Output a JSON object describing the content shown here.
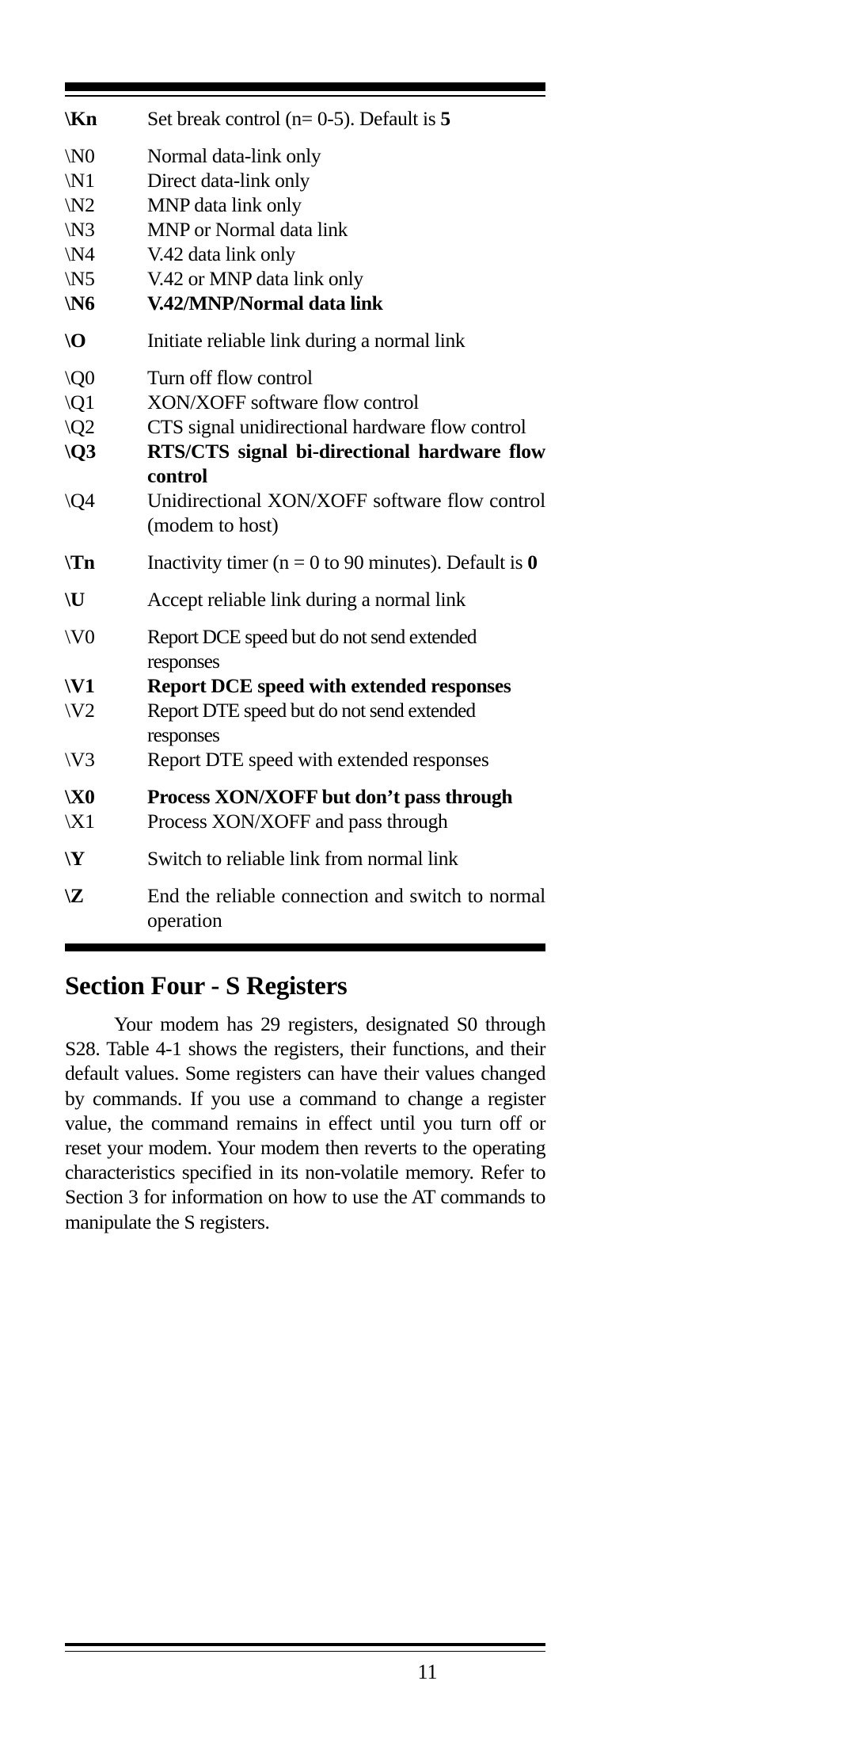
{
  "page": {
    "number": "11"
  },
  "command_table": {
    "rows": [
      {
        "label": "\\Kn",
        "desc_pre": "Set break control (n= 0-5). Default is ",
        "desc_bold_tail": "5",
        "label_bold": true,
        "desc_bold": false,
        "spacing": "none"
      },
      {
        "label": "\\N0",
        "desc": "Normal data-link only",
        "label_bold": false,
        "desc_bold": false,
        "spacing": "gap"
      },
      {
        "label": "\\N1",
        "desc": "Direct data-link only",
        "label_bold": false,
        "desc_bold": false,
        "spacing": "none"
      },
      {
        "label": "\\N2",
        "desc": "MNP data link only",
        "label_bold": false,
        "desc_bold": false,
        "spacing": "none"
      },
      {
        "label": "\\N3",
        "desc": "MNP or Normal data link",
        "label_bold": false,
        "desc_bold": false,
        "spacing": "none"
      },
      {
        "label": "\\N4",
        "desc": "V.42 data link only",
        "label_bold": false,
        "desc_bold": false,
        "spacing": "none"
      },
      {
        "label": "\\N5",
        "desc": "V.42 or MNP data link only",
        "label_bold": false,
        "desc_bold": false,
        "spacing": "none"
      },
      {
        "label": "\\N6",
        "desc": "V.42/MNP/Normal data link",
        "label_bold": true,
        "desc_bold": true,
        "spacing": "none"
      },
      {
        "label": "\\O",
        "desc": "Initiate reliable link during a normal link",
        "label_bold": true,
        "desc_bold": false,
        "spacing": "gap"
      },
      {
        "label": "\\Q0",
        "desc": "Turn off flow control",
        "label_bold": false,
        "desc_bold": false,
        "spacing": "gap"
      },
      {
        "label": "\\Q1",
        "desc": "XON/XOFF software flow control",
        "label_bold": false,
        "desc_bold": false,
        "spacing": "none"
      },
      {
        "label": "\\Q2",
        "desc": "CTS signal unidirectional hardware flow control",
        "label_bold": false,
        "desc_bold": false,
        "spacing": "none"
      },
      {
        "label": "\\Q3",
        "desc": "RTS/CTS signal bi-directional hardware flow control",
        "label_bold": true,
        "desc_bold": true,
        "spacing": "none",
        "justify": true
      },
      {
        "label": "\\Q4",
        "desc": "Unidirectional XON/XOFF software flow control (modem to host)",
        "label_bold": false,
        "desc_bold": false,
        "spacing": "none",
        "justify": true
      },
      {
        "label": "\\Tn",
        "desc_pre": "Inactivity timer (n = 0 to 90 minutes).  Default is ",
        "desc_bold_tail": "0",
        "label_bold": true,
        "desc_bold": false,
        "spacing": "gap"
      },
      {
        "label": "\\U",
        "desc": "Accept reliable link during a normal link",
        "label_bold": true,
        "desc_bold": false,
        "spacing": "gap"
      },
      {
        "label": "\\V0",
        "desc": "Report DCE speed but do not send extended responses",
        "label_bold": false,
        "desc_bold": false,
        "spacing": "gap",
        "tight": true
      },
      {
        "label": "\\V1",
        "desc": "Report DCE speed with extended responses",
        "label_bold": true,
        "desc_bold": true,
        "spacing": "none"
      },
      {
        "label": "\\V2",
        "desc": "Report DTE speed but do not send extended responses",
        "label_bold": false,
        "desc_bold": false,
        "spacing": "none",
        "tight": true
      },
      {
        "label": "\\V3",
        "desc": "Report DTE speed with extended responses",
        "label_bold": false,
        "desc_bold": false,
        "spacing": "none"
      },
      {
        "label": "\\X0",
        "desc": "Process XON/XOFF but don’t pass through",
        "label_bold": true,
        "desc_bold": true,
        "spacing": "gap"
      },
      {
        "label": "\\X1",
        "desc": "Process XON/XOFF and pass through",
        "label_bold": false,
        "desc_bold": false,
        "spacing": "none"
      },
      {
        "label": "\\Y",
        "desc": "Switch to reliable link from normal link",
        "label_bold": true,
        "desc_bold": false,
        "spacing": "gap"
      },
      {
        "label": "\\Z",
        "desc": "End the reliable connection and switch to normal operation",
        "label_bold": true,
        "desc_bold": false,
        "spacing": "gap",
        "justify": true
      }
    ]
  },
  "section": {
    "heading": "Section Four - S Registers",
    "paragraph": "Your modem has 29 registers, designated S0 through S28. Table 4-1 shows the registers, their functions, and their default values. Some registers can have their values changed by commands. If you use a command to change a register value, the command remains in effect until you turn off or reset your modem. Your modem then reverts to the operating characteristics specified in its non-volatile memory. Refer to Section 3 for information on how to use the AT commands to manipulate the S registers."
  }
}
